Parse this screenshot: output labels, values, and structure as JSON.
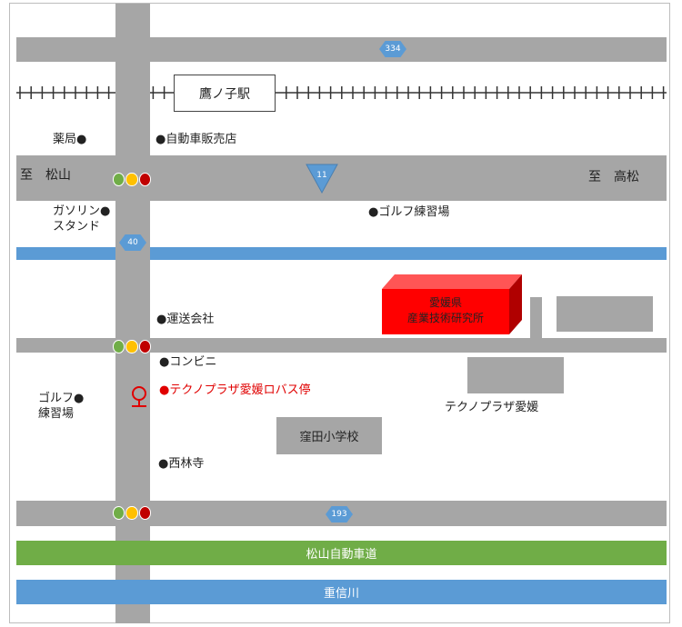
{
  "routes": {
    "r334": "334",
    "r11": "11",
    "r40": "40",
    "r193": "193"
  },
  "station": "鷹ノ子駅",
  "directions": {
    "west": "至　松山",
    "east": "至　高松"
  },
  "landmarks": {
    "pharmacy": "薬局●",
    "car_dealer": "●自動車販売店",
    "gas_station_line1": "ガソリン●",
    "gas_station_line2": "スタンド",
    "golf_range_north": "●ゴルフ練習場",
    "transport_company": "●運送会社",
    "convenience_store": "●コンビニ",
    "golf_range_west_line1": "ゴルフ●",
    "golf_range_west_line2": "練習場",
    "bus_stop": "●テクノプラザ愛媛ロバス停",
    "temple": "●西林寺",
    "school": "窪田小学校",
    "techno_plaza": "テクノプラザ愛媛"
  },
  "destination": {
    "line1": "愛媛県",
    "line2": "産業技術研究所",
    "color": "#ff0000"
  },
  "expressway": "松山自動車道",
  "river": "重信川",
  "colors": {
    "road": "#a6a6a6",
    "water": "#5b9bd5",
    "expressway": "#70ad47",
    "accent": "#e00000"
  },
  "icons": [
    "traffic-signal-icon",
    "bus-stop-icon",
    "route-shield-icon"
  ]
}
